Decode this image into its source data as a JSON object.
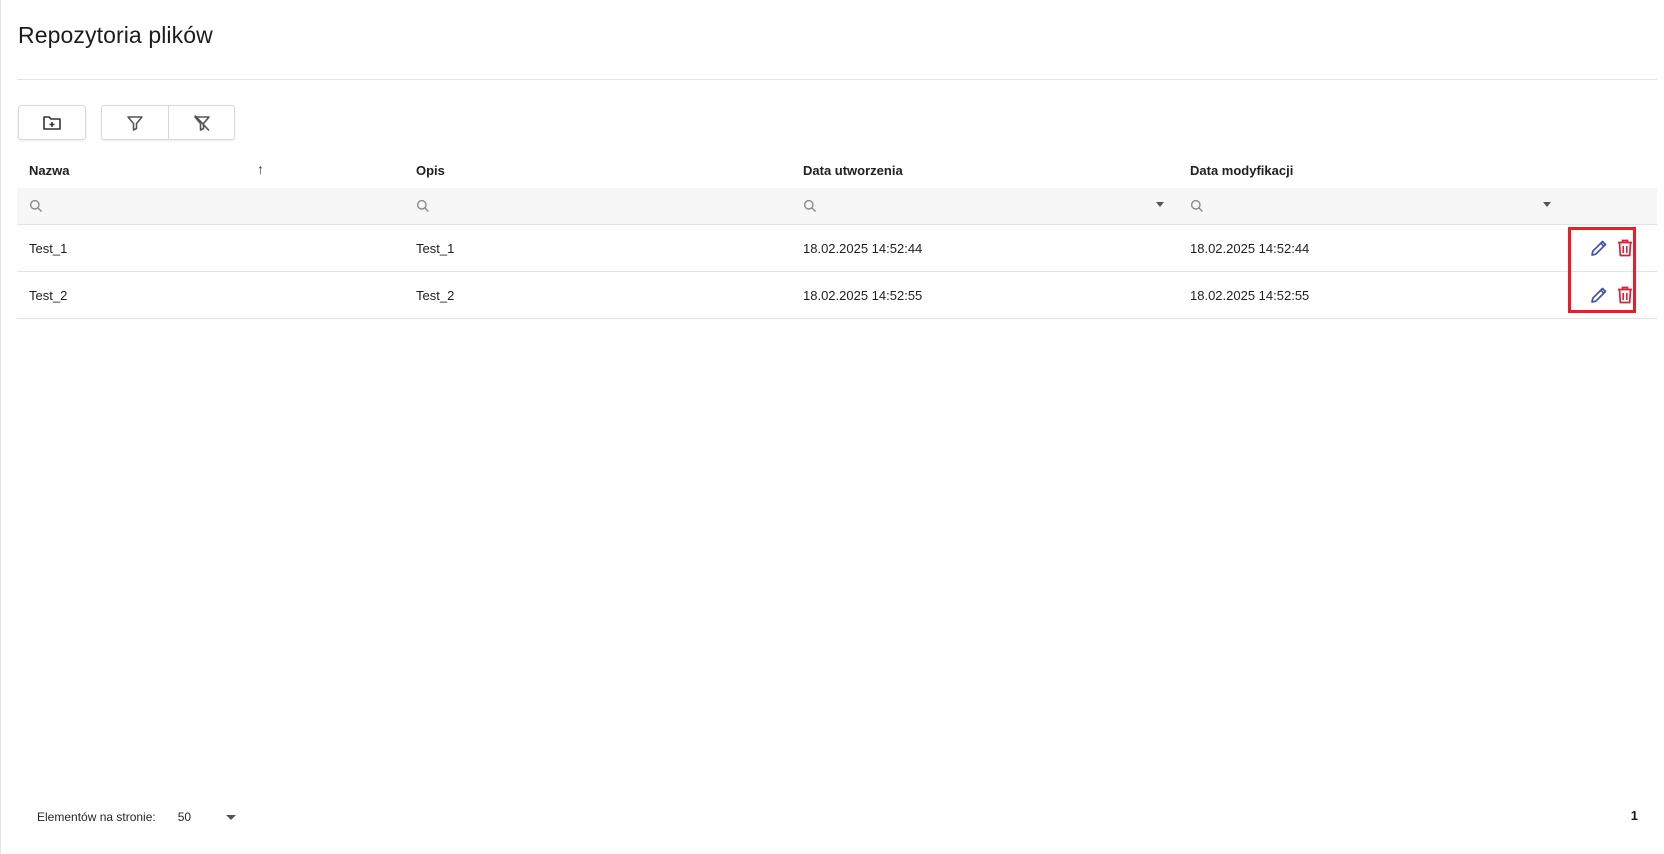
{
  "page": {
    "title": "Repozytoria plików"
  },
  "toolbar": {
    "buttons": [
      {
        "icon": "folder-plus-icon"
      },
      {
        "icon": "filter-icon"
      },
      {
        "icon": "filter-clear-icon"
      }
    ]
  },
  "table": {
    "columns": [
      {
        "label": "Nazwa",
        "sorted": "ascending"
      },
      {
        "label": "Opis"
      },
      {
        "label": "Data utworzenia"
      },
      {
        "label": "Data modyfikacji"
      }
    ],
    "filters": [
      {
        "value": "",
        "placeholder": ""
      },
      {
        "value": "",
        "placeholder": ""
      },
      {
        "value": "",
        "placeholder": ""
      },
      {
        "value": "",
        "placeholder": ""
      }
    ],
    "rows": [
      {
        "name": "Test_1",
        "description": "Test_1",
        "created": "18.02.2025 14:52:44",
        "modified": "18.02.2025 14:52:44"
      },
      {
        "name": "Test_2",
        "description": "Test_2",
        "created": "18.02.2025 14:52:55",
        "modified": "18.02.2025 14:52:55"
      }
    ],
    "action_icons": [
      "pencil-icon",
      "trash-icon"
    ]
  },
  "pager": {
    "label": "Elementów na stronie:",
    "page_size": "50",
    "current_page": "1"
  },
  "colors": {
    "edit_icon": "#3f51b5",
    "delete_icon": "#d8213b",
    "highlight": "#ee1c25",
    "divider": "#e2e2ea",
    "filter_row_bg": "#f7f7f8"
  }
}
